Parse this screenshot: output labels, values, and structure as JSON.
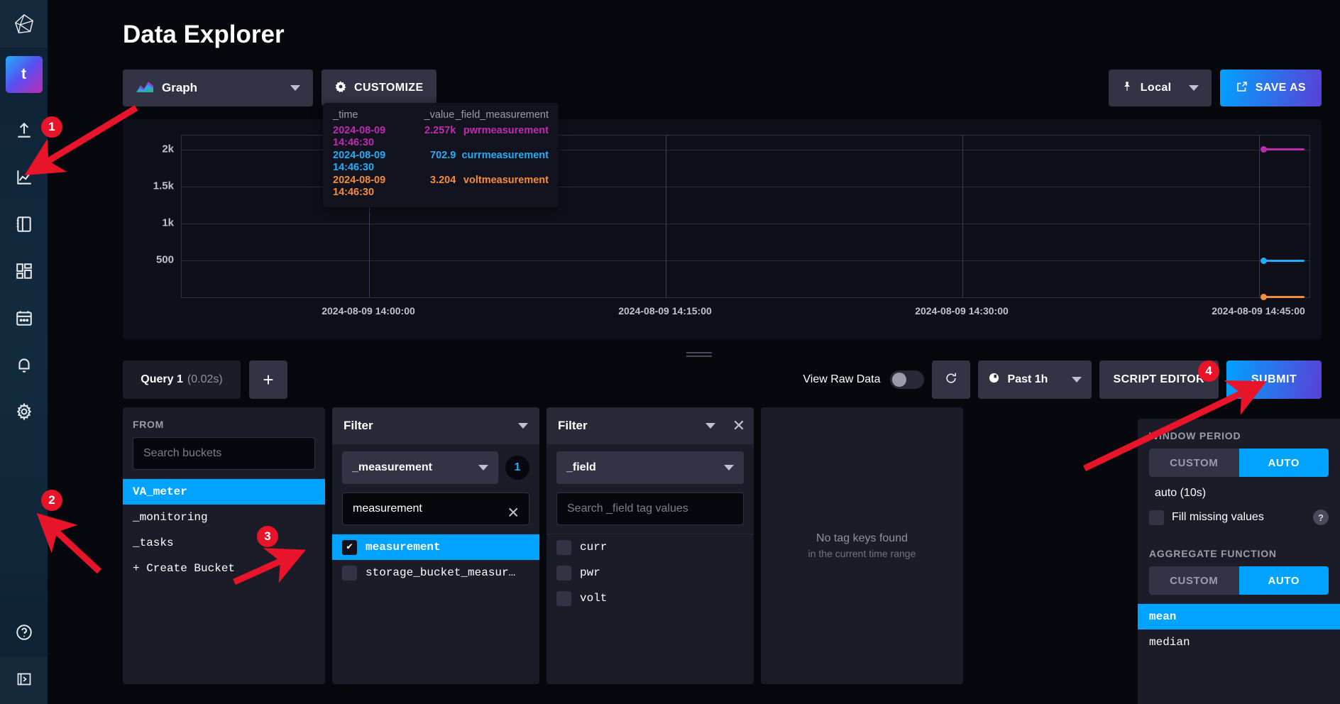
{
  "nav": {
    "logo_icon": "influxdb-logo-icon",
    "org_initial": "t",
    "items": [
      {
        "name": "load-data",
        "icon": "upload-icon"
      },
      {
        "name": "data-explorer",
        "icon": "line-chart-icon"
      },
      {
        "name": "notebooks",
        "icon": "notebook-icon"
      },
      {
        "name": "dashboards",
        "icon": "dashboards-grid-icon"
      },
      {
        "name": "tasks",
        "icon": "calendar-icon"
      },
      {
        "name": "alerts",
        "icon": "bell-icon"
      },
      {
        "name": "settings",
        "icon": "gear-icon"
      }
    ],
    "help_icon": "question-circle-icon",
    "collapse_icon": "panel-expand-icon"
  },
  "header": {
    "title": "Data Explorer"
  },
  "toolbar": {
    "viz_type": "Graph",
    "viz_icon": "area-graph-icon",
    "customize_label": "CUSTOMIZE",
    "customize_icon": "gear-icon",
    "local_label": "Local",
    "local_icon": "pin-icon",
    "save_as_label": "SAVE AS",
    "save_as_icon": "export-icon"
  },
  "graph": {
    "y_ticks": [
      "2k",
      "1.5k",
      "1k",
      "500"
    ],
    "x_ticks": [
      "2024-08-09 14:00:00",
      "2024-08-09 14:15:00",
      "2024-08-09 14:30:00",
      "2024-08-09 14:45:00"
    ],
    "series_colors": {
      "pwr": "#bf2bb0",
      "curr": "#22adf6",
      "volt": "#f48d38"
    }
  },
  "tooltip": {
    "headers": [
      "_time",
      "_value",
      "_field",
      "_measurement"
    ],
    "rows": [
      {
        "time": "2024-08-09 14:46:30",
        "value": "2.257k",
        "field": "pwr",
        "measurement": "measurement",
        "color": "#bf2bb0"
      },
      {
        "time": "2024-08-09 14:46:30",
        "value": "702.9",
        "field": "curr",
        "measurement": "measurement",
        "color": "#22adf6"
      },
      {
        "time": "2024-08-09 14:46:30",
        "value": "3.204",
        "field": "volt",
        "measurement": "measurement",
        "color": "#f48d38"
      }
    ]
  },
  "query_bar": {
    "tab_label": "Query 1",
    "tab_time": "(0.02s)",
    "add_label": "+",
    "raw_data_label": "View Raw Data",
    "raw_data_on": false,
    "refresh_icon": "refresh-icon",
    "time_range": "Past 1h",
    "time_icon": "clock-icon",
    "script_editor_label": "SCRIPT EDITOR",
    "submit_label": "SUBMIT"
  },
  "builder": {
    "from": {
      "heading": "FROM",
      "search_placeholder": "Search buckets",
      "buckets": [
        {
          "label": "VA_meter",
          "selected": true
        },
        {
          "label": "_monitoring",
          "selected": false
        },
        {
          "label": "_tasks",
          "selected": false
        },
        {
          "label": "+ Create Bucket",
          "selected": false
        }
      ]
    },
    "filter_measurement": {
      "heading": "Filter",
      "tag_key": "_measurement",
      "count": "1",
      "search_value": "measurement",
      "clear_icon": "close-icon",
      "values": [
        {
          "label": "measurement",
          "checked": true
        },
        {
          "label": "storage_bucket_measur…",
          "checked": false
        }
      ]
    },
    "filter_field": {
      "heading": "Filter",
      "tag_key": "_field",
      "search_placeholder": "Search _field tag values",
      "close_icon": "close-icon",
      "values": [
        {
          "label": "curr",
          "checked": false
        },
        {
          "label": "pwr",
          "checked": false
        },
        {
          "label": "volt",
          "checked": false
        }
      ]
    },
    "empty_column": {
      "line1": "No tag keys found",
      "line2": "in the current time range"
    }
  },
  "right_panel": {
    "window_period_label": "WINDOW PERIOD",
    "window_custom": "CUSTOM",
    "window_auto": "AUTO",
    "window_value": "auto (10s)",
    "fill_missing_label": "Fill missing values",
    "help_icon_label": "?",
    "aggregate_label": "AGGREGATE FUNCTION",
    "agg_custom": "CUSTOM",
    "agg_auto": "AUTO",
    "functions": [
      {
        "label": "mean",
        "selected": true
      },
      {
        "label": "median",
        "selected": false
      }
    ]
  },
  "annotations": {
    "markers": [
      {
        "label": "1"
      },
      {
        "label": "2"
      },
      {
        "label": "3"
      },
      {
        "label": "4"
      }
    ],
    "color": "#e8142a"
  }
}
